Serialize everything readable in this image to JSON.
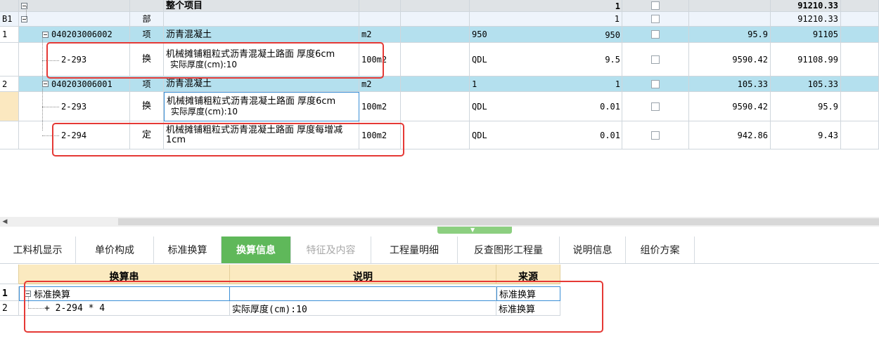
{
  "top_grid": {
    "rows": [
      {
        "idx": "",
        "code": "",
        "type": "",
        "name": "整个项目",
        "unit": "",
        "formula": "",
        "qty": "1",
        "price": "",
        "total": "91210.33"
      },
      {
        "idx": "B1",
        "code": "",
        "type": "部",
        "name": "",
        "unit": "",
        "formula": "",
        "qty": "1",
        "price": "",
        "total": "91210.33"
      },
      {
        "idx": "1",
        "code": "040203006002",
        "type": "项",
        "name": "沥青混凝土",
        "unit": "m2",
        "formula": "950",
        "qty": "950",
        "price": "95.9",
        "total": "91105"
      },
      {
        "idx": "",
        "code": "2-293",
        "type": "换",
        "name": "机械摊铺粗粒式沥青混凝土路面 厚度6cm",
        "name2": "实际厚度(cm):10",
        "unit": "100m2",
        "formula": "QDL",
        "qty": "9.5",
        "price": "9590.42",
        "total": "91108.99"
      },
      {
        "idx": "2",
        "code": "040203006001",
        "type": "项",
        "name": "沥青混凝土",
        "unit": "m2",
        "formula": "1",
        "qty": "1",
        "price": "105.33",
        "total": "105.33"
      },
      {
        "idx": "",
        "code": "2-293",
        "type": "换",
        "name": "机械摊铺粗粒式沥青混凝土路面 厚度6cm",
        "name2": "实际厚度(cm):10",
        "unit": "100m2",
        "formula": "QDL",
        "qty": "0.01",
        "price": "9590.42",
        "total": "95.9"
      },
      {
        "idx": "",
        "code": "2-294",
        "type": "定",
        "name": "机械摊铺粗粒式沥青混凝土路面 厚度每增减1cm",
        "unit": "100m2",
        "formula": "QDL",
        "qty": "0.01",
        "price": "942.86",
        "total": "9.43"
      }
    ]
  },
  "tabs": [
    {
      "label": "工料机显示",
      "state": "normal"
    },
    {
      "label": "单价构成",
      "state": "normal"
    },
    {
      "label": "标准换算",
      "state": "normal"
    },
    {
      "label": "换算信息",
      "state": "active"
    },
    {
      "label": "特征及内容",
      "state": "disabled"
    },
    {
      "label": "工程量明细",
      "state": "normal"
    },
    {
      "label": "反查图形工程量",
      "state": "normal"
    },
    {
      "label": "说明信息",
      "state": "normal"
    },
    {
      "label": "组价方案",
      "state": "normal"
    }
  ],
  "bottom_grid": {
    "headers": {
      "c1": "换算串",
      "c2": "说明",
      "c3": "来源"
    },
    "rows": [
      {
        "idx": "1",
        "str": "标准换算",
        "desc": "",
        "src": "标准换算"
      },
      {
        "idx": "2",
        "str": "+ 2-294 * 4",
        "desc": "实际厚度(cm):10",
        "src": "标准换算"
      }
    ]
  },
  "colors": {
    "selected_row": "#b4e0ee",
    "active_tab": "#5fb85a",
    "header_bg": "#fbeac0",
    "highlight_box": "#e53935"
  },
  "icons": {
    "tree_toggle": "collapse-minus",
    "scroll_left": "triangle-left",
    "splitter": "chevron-down"
  }
}
